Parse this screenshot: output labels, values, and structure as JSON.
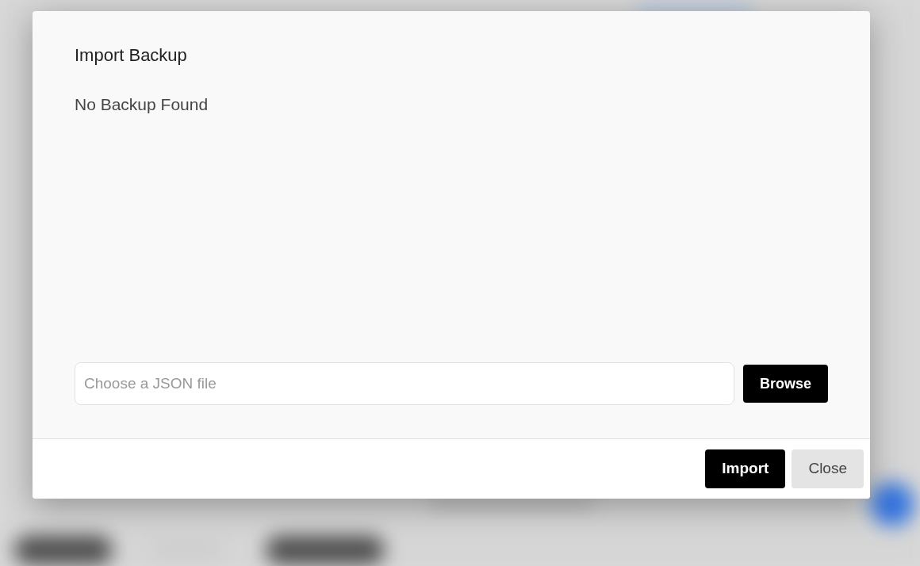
{
  "dialog": {
    "title": "Import Backup",
    "message": "No Backup Found",
    "file_field": {
      "placeholder": "Choose a JSON file"
    },
    "browse_button": "Browse",
    "buttons": [
      {
        "label": "Import",
        "kind": "primary"
      },
      {
        "label": "Close",
        "kind": "secondary"
      }
    ]
  }
}
